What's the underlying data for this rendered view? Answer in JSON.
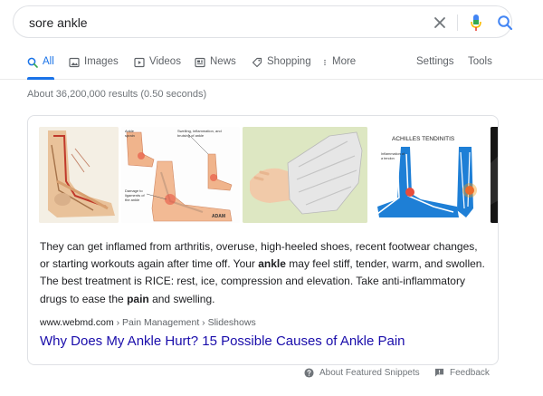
{
  "search": {
    "query": "sore ankle"
  },
  "tabs": [
    {
      "label": "All",
      "icon": "search-icon"
    },
    {
      "label": "Images",
      "icon": "image-icon"
    },
    {
      "label": "Videos",
      "icon": "video-icon"
    },
    {
      "label": "News",
      "icon": "news-icon"
    },
    {
      "label": "Shopping",
      "icon": "tag-icon"
    },
    {
      "label": "More",
      "icon": "more-vert-icon"
    },
    {
      "label": "Settings"
    },
    {
      "label": "Tools"
    }
  ],
  "results": {
    "stats": "About 36,200,000 results (0.50 seconds)"
  },
  "snippet": {
    "images": [
      {
        "label_1": "",
        "label_2": ""
      },
      {
        "label_1": "Swelling, inflammation, and bruising of ankle",
        "label_2": "Damage to ligaments of the ankle",
        "label_3": "Ankle sprain",
        "credit": "ADAM"
      },
      {
        "label_1": ""
      },
      {
        "title": "ACHILLES TENDINITIS",
        "label_1": "Inflammation of a tendon"
      },
      {
        "label_1": ""
      }
    ],
    "text_parts": [
      "They can get inflamed from arthritis, overuse, high-heeled shoes, recent footwear changes, or starting workouts again after time off. Your ",
      "ankle",
      " may feel stiff, tender, warm, and swollen. The best treatment is RICE: rest, ice, compression and elevation. Take anti-inflammatory drugs to ease the ",
      "pain",
      " and swelling."
    ],
    "cite_domain": "www.webmd.com",
    "cite_path": " › Pain Management › Slideshows",
    "title": "Why Does My Ankle Hurt? 15 Possible Causes of Ankle Pain"
  },
  "footer": {
    "about": "About Featured Snippets",
    "feedback": "Feedback"
  },
  "colors": {
    "link": "#1a0dab",
    "accent_blue": "#1a73e8",
    "gray_text": "#70757a",
    "border": "#dfe1e5"
  }
}
